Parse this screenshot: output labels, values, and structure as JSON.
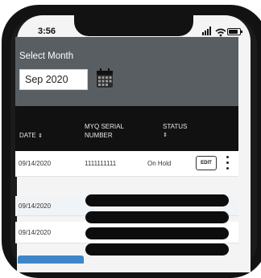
{
  "status_bar": {
    "time": "3:56"
  },
  "header": {
    "select_month_label": "Select Month",
    "month_value": "Sep 2020"
  },
  "table": {
    "columns": [
      {
        "label": "DATE",
        "sort_icon": "⇕"
      },
      {
        "label": "MYQ SERIAL NUMBER"
      },
      {
        "label": "STATUS",
        "sort_icon": "⇕"
      }
    ],
    "rows": [
      {
        "date": "09/14/2020",
        "serial": "1111111111",
        "status": "On Hold",
        "action": "EDIT"
      },
      {
        "date": "09/14/2020"
      },
      {
        "date": "09/14/2020"
      }
    ]
  },
  "colors": {
    "header_bg": "#595e62",
    "table_head_bg": "#111111",
    "accent": "#3f86c8"
  },
  "icons": [
    "calendar-icon",
    "kebab-icon",
    "signal-icon",
    "wifi-icon",
    "battery-icon"
  ]
}
